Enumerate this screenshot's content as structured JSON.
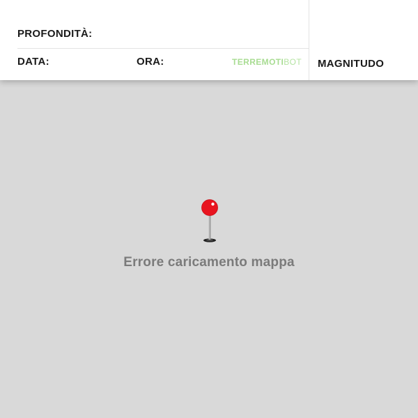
{
  "header": {
    "depth_label": "PROFONDITÀ:",
    "date_label": "DATA:",
    "time_label": "ORA:",
    "brand": {
      "part_a": "TERREMOTI",
      "part_b": "BOT",
      "color": "#a8dc92"
    },
    "magnitude_label": "MAGNITUDO"
  },
  "map": {
    "background_color": "#d9d9d9",
    "pin_icon": "map-pin-icon",
    "pin_color": "#e8141f",
    "error_message": "Errore caricamento mappa"
  }
}
